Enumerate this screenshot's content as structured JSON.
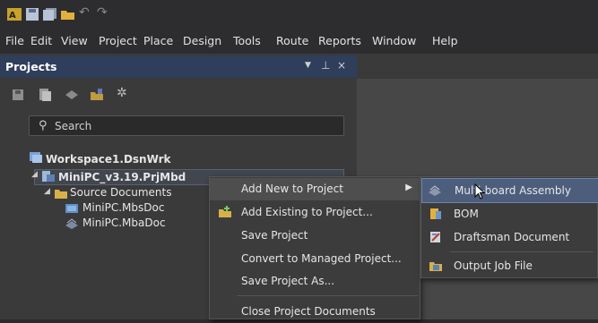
{
  "menubar": {
    "items": [
      "File",
      "Edit",
      "View",
      "Project",
      "Place",
      "Design",
      "Tools",
      "Route",
      "Reports",
      "Window",
      "Help"
    ]
  },
  "projects_panel": {
    "title": "Projects",
    "header_icons": [
      "dropdown-arrow-icon",
      "pin-icon",
      "close-icon"
    ],
    "search": {
      "placeholder": "Search"
    },
    "tree": {
      "workspace": "Workspace1.DsnWrk",
      "project": "MiniPC_v3.19.PrjMbd",
      "folder": "Source Documents",
      "files": [
        "MiniPC.MbsDoc",
        "MiniPC.MbaDoc"
      ]
    }
  },
  "context_menu": {
    "items": [
      {
        "label": "Add New to Project",
        "has_submenu": true,
        "highlighted": true
      },
      {
        "label": "Add Existing to Project...",
        "icon": "add-folder-icon"
      },
      {
        "label": "Save Project"
      },
      {
        "label": "Convert to Managed Project..."
      },
      {
        "label": "Save Project As..."
      },
      {
        "label": "Close Project Documents"
      }
    ]
  },
  "submenu": {
    "items": [
      {
        "label": "Multi-board Assembly",
        "icon": "assembly-icon",
        "highlighted": true
      },
      {
        "label": "BOM",
        "icon": "bom-icon"
      },
      {
        "label": "Draftsman Document",
        "icon": "draftsman-icon"
      },
      {
        "label": "Output Job File",
        "icon": "outjob-icon"
      }
    ]
  },
  "colors": {
    "panel_header": "#2f3e5b",
    "highlight": "#4d5e7d",
    "background": "#3a3a3a"
  }
}
